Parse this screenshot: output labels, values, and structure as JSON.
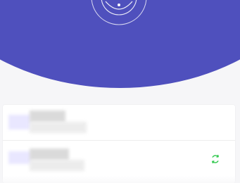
{
  "colors": {
    "hero_background": "#4f50bd",
    "page_background": "#f6f6f8",
    "card_background": "#ffffff",
    "refresh_icon": "#2fc84c"
  },
  "header": {
    "logo_icon": "target-rings-icon"
  },
  "list": {
    "items": [
      {
        "title": "",
        "subtitle": ""
      },
      {
        "title": "",
        "subtitle": "",
        "action_icon": "refresh-icon"
      }
    ]
  }
}
